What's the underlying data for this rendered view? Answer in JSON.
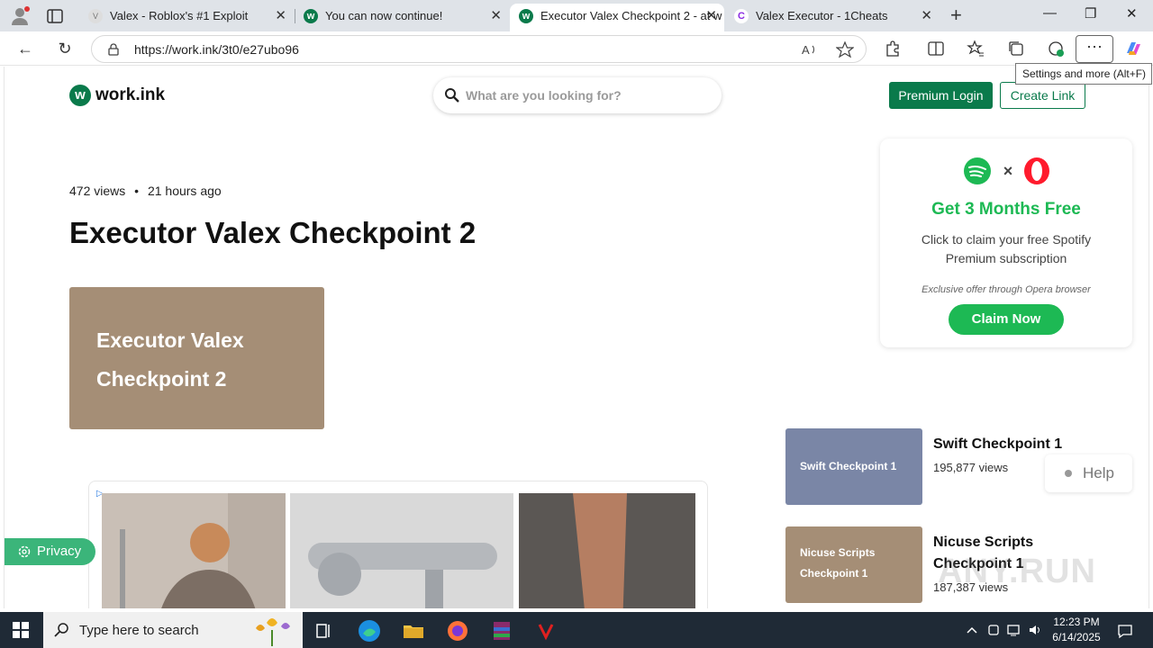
{
  "browser": {
    "tabs": [
      {
        "title": "Valex - Roblox's #1 Exploit",
        "active": false
      },
      {
        "title": "You can now continue!",
        "active": false
      },
      {
        "title": "Executor Valex Checkpoint 2 - at w",
        "active": true
      },
      {
        "title": "Valex Executor - 1Cheats",
        "active": false
      }
    ],
    "url": "https://work.ink/3t0/e27ubo96",
    "tooltip": "Settings and more (Alt+F)"
  },
  "header": {
    "logo_text": "work.ink",
    "logo_mark": "w",
    "search_placeholder": "What are you looking for?",
    "premium_label": "Premium Login",
    "create_label": "Create Link"
  },
  "post": {
    "views": "472 views",
    "separator": "•",
    "age": "21 hours ago",
    "title": "Executor Valex Checkpoint 2",
    "thumb_line1": "Executor Valex",
    "thumb_line2": "Checkpoint 2"
  },
  "promo": {
    "x_symbol": "×",
    "headline": "Get 3 Months Free",
    "description": "Click to claim your free Spotify Premium subscription",
    "exclusive": "Exclusive offer through Opera browser",
    "button": "Claim Now",
    "accent": "#1db954"
  },
  "related": [
    {
      "thumb": "Swift Checkpoint 1",
      "title": "Swift Checkpoint 1",
      "views": "195,877 views",
      "color": "#7a86a6"
    },
    {
      "thumb_line1": "Nicuse Scripts",
      "thumb_line2": "Checkpoint 1",
      "title": "Nicuse Scripts Checkpoint 1",
      "views": "187,387 views",
      "color": "#a58e76"
    }
  ],
  "widgets": {
    "privacy": "Privacy",
    "help": "Help",
    "watermark": "ANY.RUN"
  },
  "taskbar": {
    "search_placeholder": "Type here to search",
    "time": "12:23 PM",
    "date": "6/14/2025"
  },
  "colors": {
    "brand": "#0a7a4b",
    "thumb_brown": "#a58e76"
  }
}
